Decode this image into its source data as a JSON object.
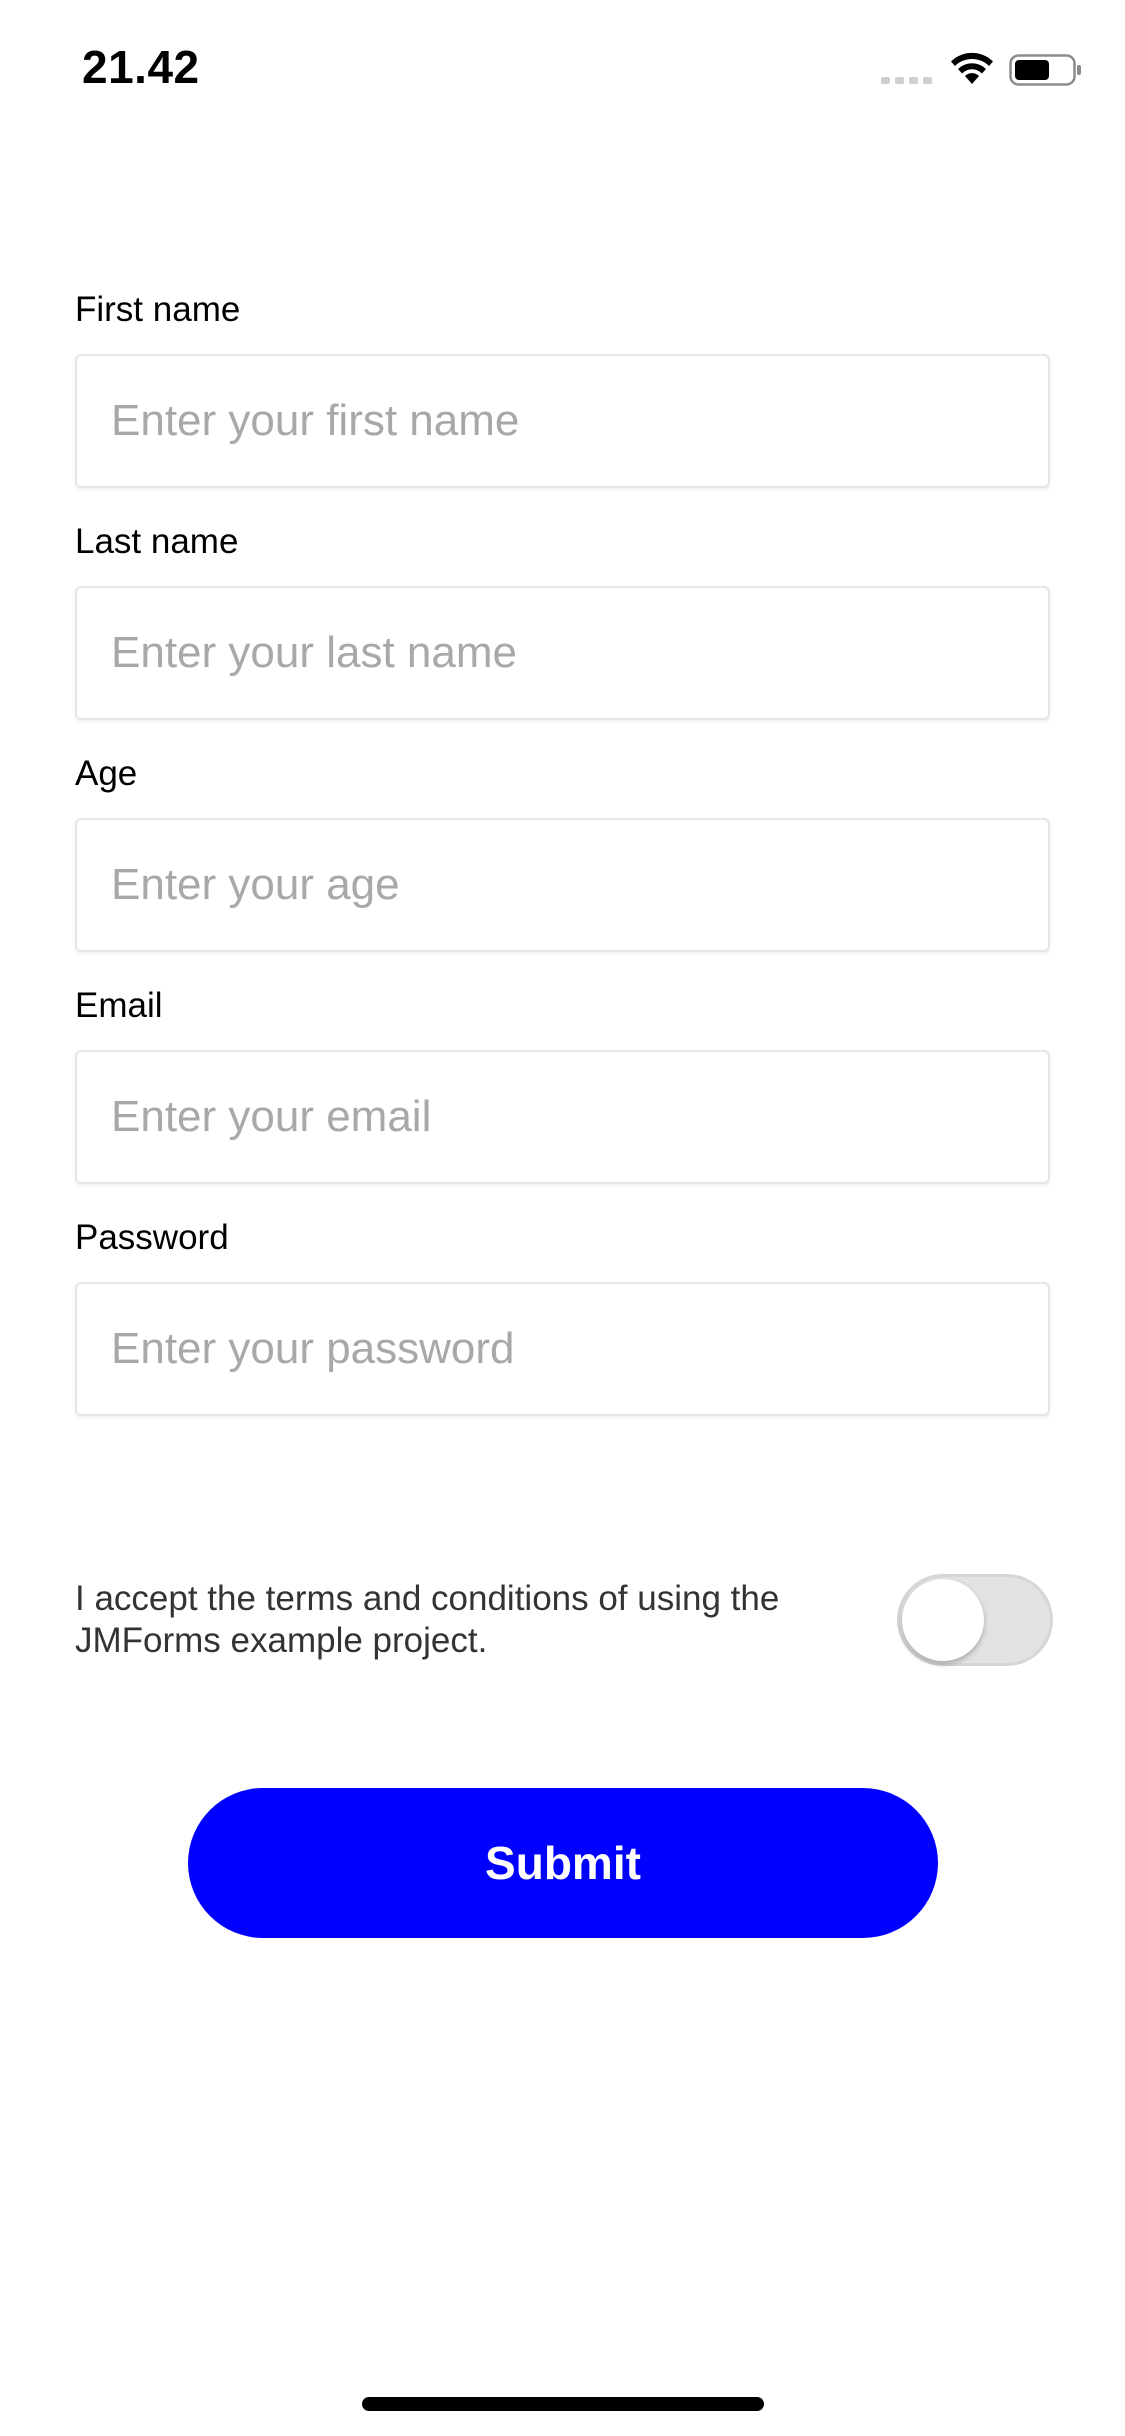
{
  "status_bar": {
    "time": "21.42",
    "icons": [
      "signal-icon",
      "wifi-icon",
      "battery-icon"
    ]
  },
  "form": {
    "fields": [
      {
        "label": "First name",
        "placeholder": "Enter your first name",
        "value": ""
      },
      {
        "label": "Last name",
        "placeholder": "Enter your last name",
        "value": ""
      },
      {
        "label": "Age",
        "placeholder": "Enter your age",
        "value": ""
      },
      {
        "label": "Email",
        "placeholder": "Enter your email",
        "value": ""
      },
      {
        "label": "Password",
        "placeholder": "Enter your password",
        "value": ""
      }
    ],
    "terms": {
      "text": "I accept the terms and conditions of using the JMForms example project.",
      "accepted": false
    },
    "submit_label": "Submit"
  },
  "colors": {
    "accent": "#0000ff",
    "placeholder": "#a8a8a8",
    "toggle_off": "#e2e2e2"
  }
}
